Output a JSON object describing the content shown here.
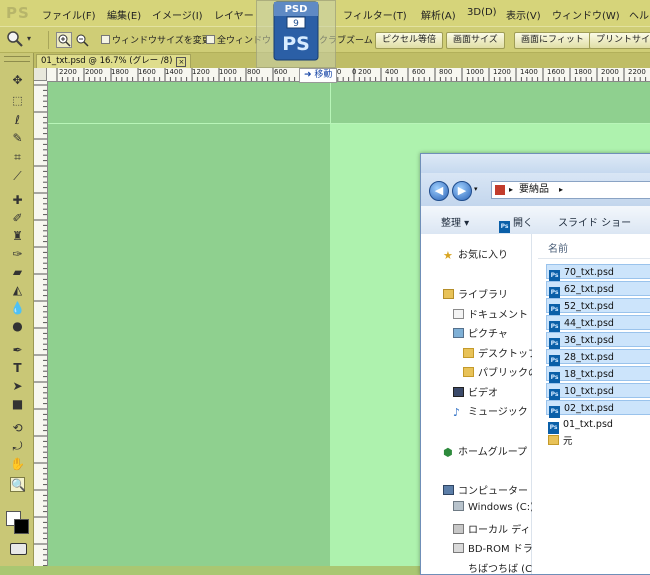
{
  "app": {
    "logo": "PS"
  },
  "menu": [
    "ファイル(F)",
    "編集(E)",
    "イメージ(I)",
    "レイヤー",
    "フィルター(T)",
    "解析(A)",
    "3D(D)",
    "表示(V)",
    "ウィンドウ(W)",
    "ヘル"
  ],
  "options": {
    "checkbox_resize": "ウィンドウサイズを変更",
    "checkbox_all_windows": "全ウィンドウ",
    "scrubby_zoom": "スクラブズーム",
    "btn_actual_pixels": "ピクセル等倍",
    "btn_screen_size": "画面サイズ",
    "btn_fit_screen": "画面にフィット",
    "btn_print_size": "プリントサイズ"
  },
  "document_tab": {
    "title": "01_txt.psd @ 16.7% (グレー /8)",
    "close": "×"
  },
  "ruler": {
    "labels": [
      "2200",
      "2000",
      "1800",
      "1600",
      "1400",
      "1200",
      "1000",
      "800",
      "600",
      "400",
      "200",
      "0",
      "200",
      "400",
      "600",
      "800",
      "1000",
      "1200",
      "1400",
      "1600",
      "1800",
      "2000",
      "2200"
    ]
  },
  "drag_ghost": {
    "top_label": "PSD",
    "badge": "9",
    "mark": "PS"
  },
  "move_tooltip": "➜ 移動",
  "explorer": {
    "address": [
      "要納品"
    ],
    "commands": {
      "organize": "整理 ▾",
      "open": "開く",
      "slideshow": "スライド ショー"
    },
    "column_header": "名前",
    "nav": {
      "favorites": "お気に入り",
      "libraries": "ライブラリ",
      "documents": "ドキュメント",
      "pictures": "ピクチャ",
      "desktop": "デスクトップ",
      "public": "パブリックの",
      "videos": "ビデオ",
      "music": "ミュージック",
      "homegroup": "ホームグループ",
      "computer": "コンピューター",
      "windows_c": "Windows (C:)",
      "local_d": "ローカル ディ",
      "bdrom": "BD-ROM ドラ",
      "cut": "ちばつちば (C"
    },
    "files": [
      {
        "name": "70_txt.psd",
        "selected": true
      },
      {
        "name": "62_txt.psd",
        "selected": true
      },
      {
        "name": "52_txt.psd",
        "selected": true
      },
      {
        "name": "44_txt.psd",
        "selected": true
      },
      {
        "name": "36_txt.psd",
        "selected": true
      },
      {
        "name": "28_txt.psd",
        "selected": true
      },
      {
        "name": "18_txt.psd",
        "selected": true
      },
      {
        "name": "10_txt.psd",
        "selected": true
      },
      {
        "name": "02_txt.psd",
        "selected": true
      },
      {
        "name": "01_txt.psd",
        "selected": false
      },
      {
        "name": "元",
        "selected": false,
        "folder": true
      }
    ]
  }
}
